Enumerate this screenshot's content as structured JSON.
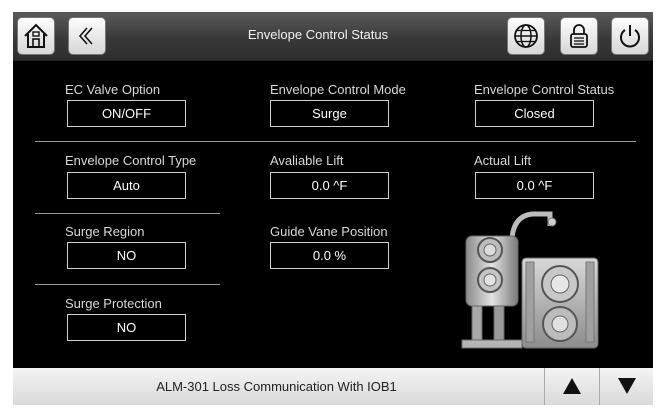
{
  "header": {
    "title": "Envelope Control Status",
    "icons": [
      "home-icon",
      "back-icon",
      "globe-icon",
      "lock-icon",
      "power-icon"
    ]
  },
  "fields": {
    "ec_valve_option": {
      "label": "EC Valve Option",
      "value": "ON/OFF"
    },
    "envelope_control_mode": {
      "label": "Envelope Control Mode",
      "value": "Surge"
    },
    "envelope_control_status": {
      "label": "Envelope Control Status",
      "value": "Closed"
    },
    "envelope_control_type": {
      "label": "Envelope Control Type",
      "value": "Auto"
    },
    "available_lift": {
      "label": "Avaliable Lift",
      "value": "0.0 ^F"
    },
    "actual_lift": {
      "label": "Actual Lift",
      "value": "0.0 ^F"
    },
    "surge_region": {
      "label": "Surge Region",
      "value": "NO"
    },
    "guide_vane_position": {
      "label": "Guide Vane Position",
      "value": "0.0 %"
    },
    "surge_protection": {
      "label": "Surge Protection",
      "value": "NO"
    }
  },
  "footer": {
    "alarm_text": "ALM-301 Loss Communication With IOB1",
    "icons": [
      "arrow-up-icon",
      "arrow-down-icon"
    ]
  }
}
